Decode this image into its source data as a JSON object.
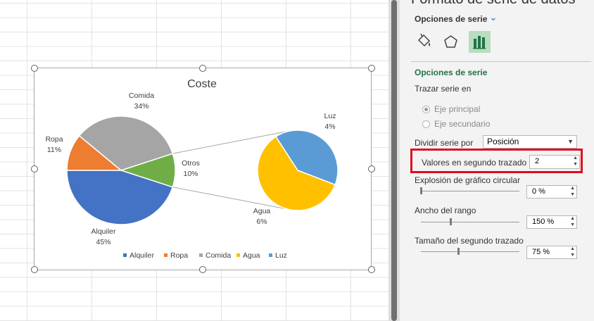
{
  "panel": {
    "top_title": "Formato de serie de datos",
    "title": "Opciones de serie",
    "section": "Opciones de serie",
    "plot_on_label": "Trazar serie en",
    "primary_axis": "Eje principal",
    "secondary_axis": "Eje secundario",
    "split_label": "Dividir serie por",
    "split_value": "Posición",
    "values_label": "Valores en segundo trazado",
    "values_value": "2",
    "explosion_label": "Explosión de gráfico circular",
    "explosion_value": "0 %",
    "gap_label": "Ancho del rango",
    "gap_value": "150 %",
    "size_label": "Tamaño del segundo trazado",
    "size_value": "75 %"
  },
  "chart_data": {
    "type": "pie",
    "title": "Coste",
    "subtype": "pie-of-pie",
    "categories": [
      "Alquiler",
      "Ropa",
      "Comida",
      "Agua",
      "Luz"
    ],
    "colors": [
      "#4472c4",
      "#ed7d31",
      "#a5a5a5",
      "#ffc000",
      "#5b9bd5"
    ],
    "other_color": "#70ad47",
    "main_pie": [
      {
        "name": "Alquiler",
        "percent": 45
      },
      {
        "name": "Ropa",
        "percent": 11
      },
      {
        "name": "Comida",
        "percent": 34
      },
      {
        "name": "Otros",
        "percent": 10
      }
    ],
    "second_pie": [
      {
        "name": "Agua",
        "percent": 6
      },
      {
        "name": "Luz",
        "percent": 4
      }
    ],
    "data_labels": [
      {
        "key": "Comida",
        "name": "Comida",
        "value": "34%"
      },
      {
        "key": "Ropa",
        "name": "Ropa",
        "value": "11%"
      },
      {
        "key": "Otros",
        "name": "Otros",
        "value": "10%"
      },
      {
        "key": "Alquiler",
        "name": "Alquiler",
        "value": "45%"
      },
      {
        "key": "Luz",
        "name": "Luz",
        "value": "4%"
      },
      {
        "key": "Agua",
        "name": "Agua",
        "value": "6%"
      }
    ],
    "legend": [
      "Alquiler",
      "Ropa",
      "Comida",
      "Agua",
      "Luz"
    ],
    "legend_position": "bottom"
  }
}
